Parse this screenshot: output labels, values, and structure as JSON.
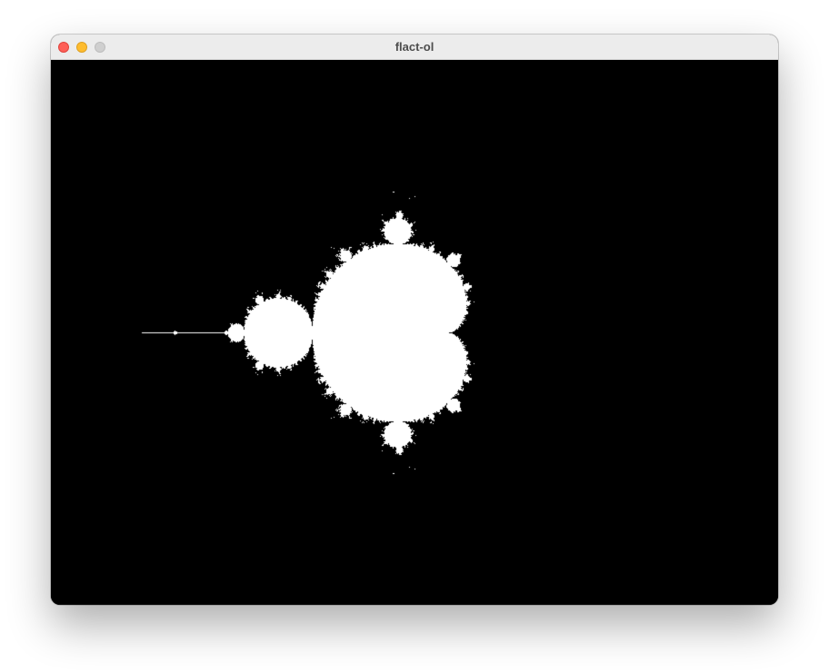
{
  "window": {
    "title": "flact-ol",
    "buttons": [
      "close",
      "minimize",
      "zoom"
    ]
  },
  "fractal": {
    "type": "Mandelbrot set",
    "colors": {
      "inside": "#ffffff",
      "outside": "#000000"
    }
  }
}
